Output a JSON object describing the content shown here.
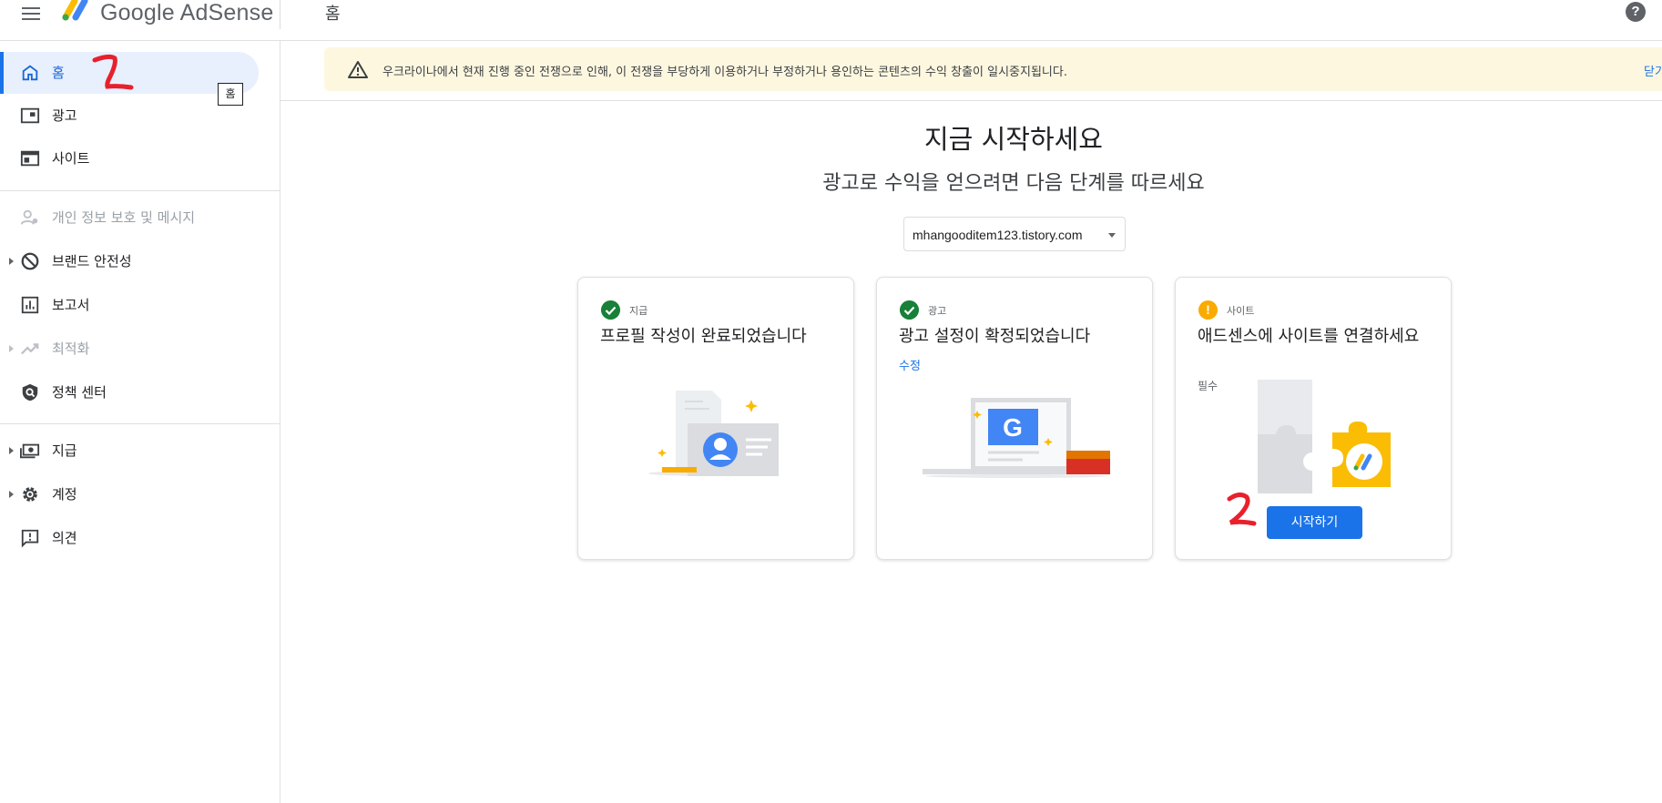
{
  "app": {
    "logo_text": "Google AdSense",
    "page_heading": "홈",
    "help_icon": "?"
  },
  "sidebar": {
    "items": [
      {
        "label": "홈",
        "icon": "home-icon",
        "active": true
      },
      {
        "label": "광고",
        "icon": "ads-icon"
      },
      {
        "label": "사이트",
        "icon": "sites-icon"
      },
      {
        "label": "개인 정보 보호 및 메시지",
        "icon": "privacy-icon",
        "disabled": true
      },
      {
        "label": "브랜드 안전성",
        "icon": "block-icon",
        "expandable": true
      },
      {
        "label": "보고서",
        "icon": "reports-icon"
      },
      {
        "label": "최적화",
        "icon": "optimization-icon",
        "expandable": true,
        "disabled": true
      },
      {
        "label": "정책 센터",
        "icon": "policy-shield-icon"
      },
      {
        "label": "지급",
        "icon": "payments-icon",
        "expandable": true
      },
      {
        "label": "계정",
        "icon": "gear-icon",
        "expandable": true
      },
      {
        "label": "의견",
        "icon": "feedback-icon"
      }
    ],
    "tooltip": "홈"
  },
  "banner": {
    "text": "우크라이나에서 현재 진행 중인 전쟁으로 인해, 이 전쟁을 부당하게 이용하거나 부정하거나 용인하는 콘텐츠의 수익 창출이 일시중지됩니다.",
    "close_label": "닫기"
  },
  "main": {
    "title": "지금 시작하세요",
    "subtitle": "광고로 수익을 얻으려면 다음 단계를 따르세요",
    "site_selector": "mhangooditem123.tistory.com"
  },
  "cards": [
    {
      "category": "지급",
      "title": "프로필 작성이 완료되었습니다",
      "status": "complete"
    },
    {
      "category": "광고",
      "title": "광고 설정이 확정되었습니다",
      "status": "complete",
      "link": "수정"
    },
    {
      "category": "사이트",
      "title": "애드센스에 사이트를 연결하세요",
      "status": "required",
      "required_label": "필수",
      "button": "시작하기"
    }
  ],
  "colors": {
    "primary": "#1a73e8",
    "active_bg": "#e8f0fe",
    "success": "#188038",
    "warning": "#f9ab00",
    "banner_bg": "#fef7e0",
    "annotation": "#e8202c"
  }
}
